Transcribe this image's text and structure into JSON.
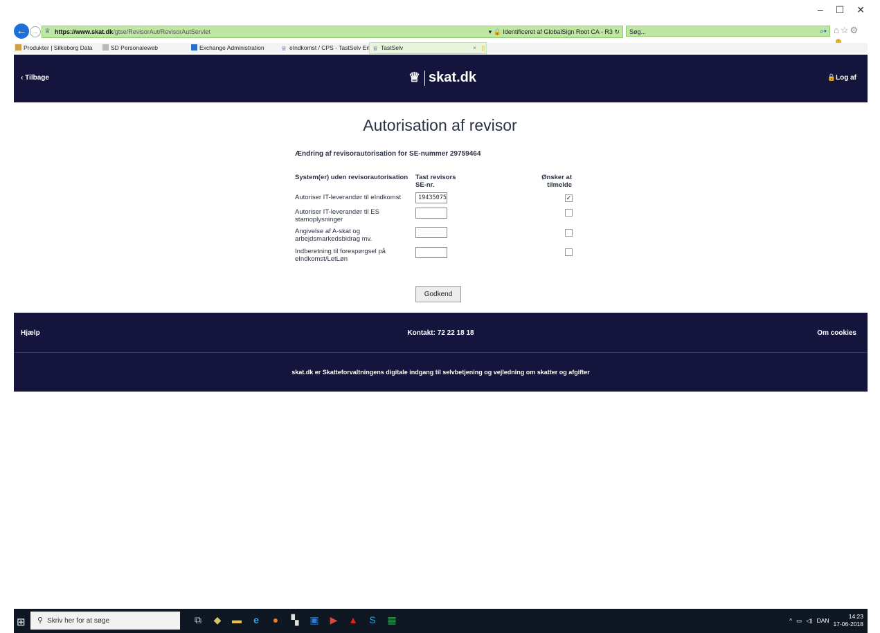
{
  "browser": {
    "window_controls": [
      "–",
      "☐",
      "✕"
    ],
    "url_host": "https://www.skat.dk",
    "url_path": "/gtse/RevisorAut/RevisorAutServlet",
    "identity": "Identificeret af GlobalSign Root CA - R3",
    "search_placeholder": "Søg...",
    "favorites": [
      "Produkter | Silkeborg Data",
      "SD Personaleweb",
      "Exchange Administration",
      "eIndkomst / CPS - TastSelv Erh...",
      "TastSelv"
    ]
  },
  "header": {
    "back_label": "Tilbage",
    "logo_text": "skat.dk",
    "logout_label": "Log af"
  },
  "main": {
    "title": "Autorisation af revisor",
    "subtitle": "Ændring af revisorautorisation for SE-nummer 29759464",
    "col_system": "System(er) uden revisorautorisation",
    "col_se_line1": "Tast revisors",
    "col_se_line2": "SE-nr.",
    "col_enroll_line1": "Ønsker at",
    "col_enroll_line2": "tilmelde",
    "rows": [
      {
        "label_1": "Autoriser IT-leverandør til eIndkomst",
        "label_2": "",
        "se_value": "19435075",
        "checked": true
      },
      {
        "label_1": "Autoriser IT-leverandør til ES",
        "label_2": "stamoplysninger",
        "se_value": "",
        "checked": false
      },
      {
        "label_1": "Angivelse af A-skat og",
        "label_2": "arbejdsmarkedsbidrag mv.",
        "se_value": "",
        "checked": false
      },
      {
        "label_1": "Indberetning til forespørgsel på",
        "label_2": "eIndkomst/LetLøn",
        "se_value": "",
        "checked": false
      }
    ],
    "submit_label": "Godkend"
  },
  "footer": {
    "help": "Hjælp",
    "contact": "Kontakt: 72 22 18 18",
    "cookies": "Om cookies",
    "description": "skat.dk er Skatteforvaltningens digitale indgang til selvbetjening og vejledning om skatter og afgifter"
  },
  "taskbar": {
    "search_placeholder": "Skriv her for at søge",
    "language": "DAN",
    "time": "14:23",
    "date": "17-06-2018"
  },
  "colors": {
    "brand_navy": "#14143c",
    "address_green": "#bfe7a4"
  }
}
